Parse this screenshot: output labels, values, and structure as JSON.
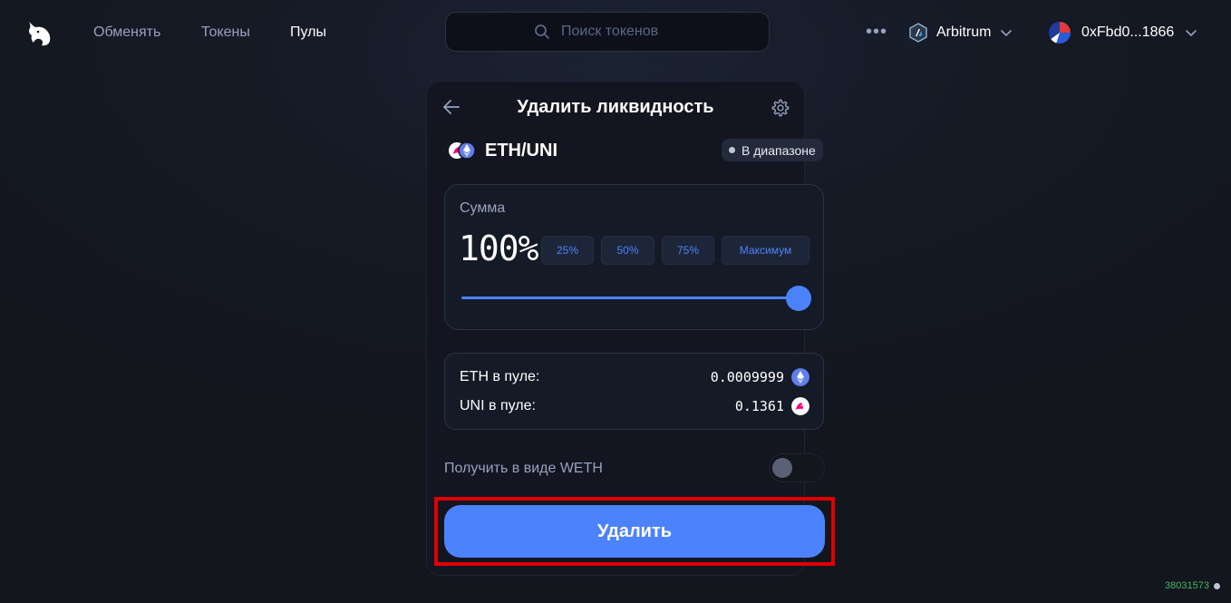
{
  "nav": {
    "logo_icon": "unicorn-logo-icon",
    "links": [
      {
        "label": "Обменять"
      },
      {
        "label": "Токены"
      },
      {
        "label": "Пулы",
        "active": true
      }
    ],
    "search_placeholder": "Поиск токенов",
    "more_label": "•••",
    "network": {
      "label": "Arbitrum",
      "icon": "arbitrum-icon"
    },
    "account": {
      "label": "0xFbd0...1866",
      "icon": "wallet-avatar-icon"
    }
  },
  "card": {
    "title": "Удалить ликвидность",
    "pair": {
      "name": "ETH/UNI",
      "badge": "В диапазоне"
    },
    "amount": {
      "label": "Сумма",
      "value": "100%",
      "percent": 100,
      "buttons": [
        "25%",
        "50%",
        "75%",
        "Максимум"
      ]
    },
    "pool": [
      {
        "label": "ETH в пуле:",
        "value": "0.0009999",
        "icon": "eth-icon"
      },
      {
        "label": "UNI в пуле:",
        "value": "0.1361",
        "icon": "uni-icon"
      }
    ],
    "weth_toggle": {
      "label": "Получить в виде WETH",
      "on": false
    },
    "submit_label": "Удалить"
  },
  "footer": {
    "block_number": "38031573"
  },
  "colors": {
    "accent": "#4c82fb",
    "highlight": "#e00000",
    "block": "#40b66b"
  }
}
